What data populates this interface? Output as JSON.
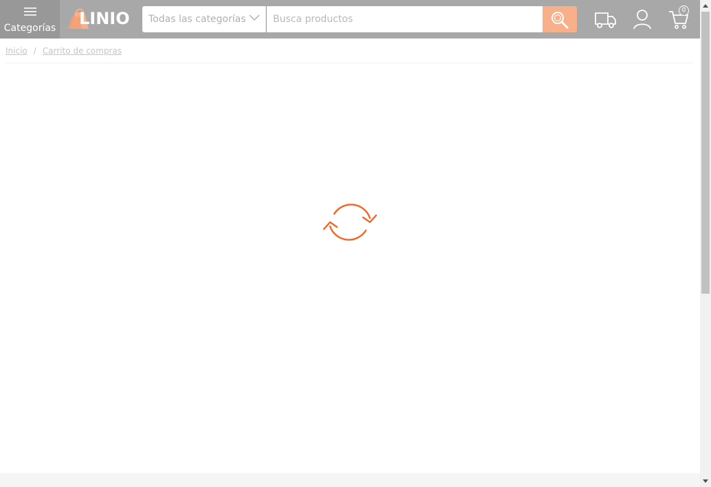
{
  "header": {
    "categories_label": "Categorías",
    "logo_text": "LINIO",
    "category_select_value": "Todas las categorías",
    "search_placeholder": "Busca productos",
    "cart_count": "0"
  },
  "breadcrumb": {
    "items": [
      "Inicio",
      "Carrito de compras"
    ],
    "separator": "/"
  },
  "colors": {
    "header_bg": "#a8a8a8",
    "brand_orange": "#f26522",
    "search_button": "#f7b08a"
  },
  "icons": {
    "menu": "hamburger-icon",
    "search": "search-icon",
    "shipping": "truck-icon",
    "account": "user-icon",
    "cart": "cart-icon",
    "loading": "refresh-spinner-icon"
  }
}
